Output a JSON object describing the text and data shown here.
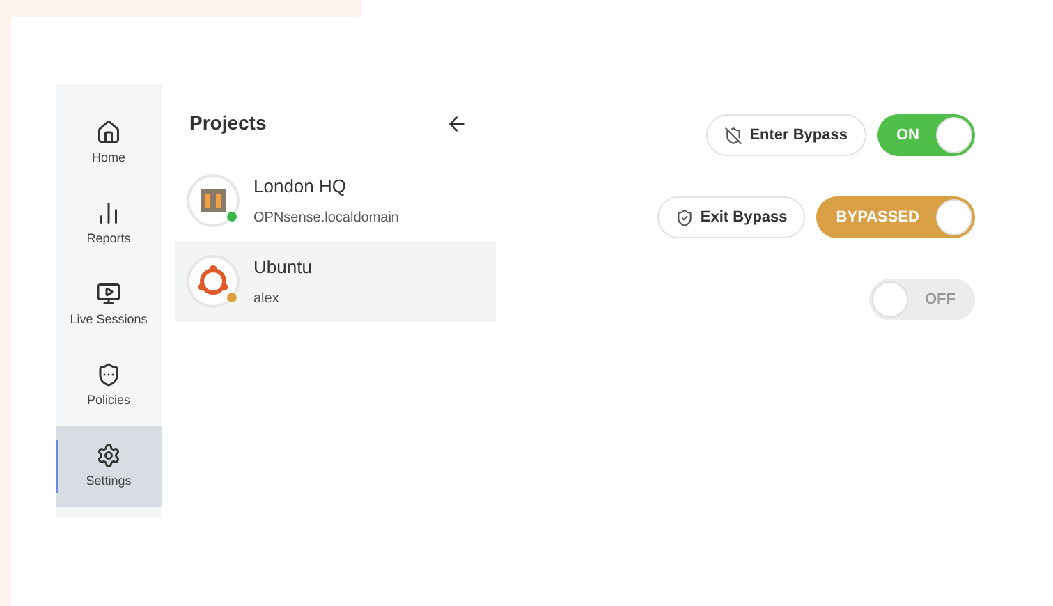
{
  "sidebar": {
    "items": [
      {
        "label": "Home",
        "selected": false
      },
      {
        "label": "Reports",
        "selected": false
      },
      {
        "label": "Live Sessions",
        "selected": false
      },
      {
        "label": "Policies",
        "selected": false
      },
      {
        "label": "Settings",
        "selected": true
      }
    ]
  },
  "projects": {
    "title": "Projects",
    "items": [
      {
        "name": "London HQ",
        "subtitle": "OPNsense.localdomain",
        "color": "#3cb84a",
        "selected": false,
        "kind": "firewall"
      },
      {
        "name": "Ubuntu",
        "subtitle": "alex",
        "color": "#e0a040",
        "selected": true,
        "kind": "ubuntu"
      }
    ]
  },
  "controls": [
    {
      "button": {
        "label": "Enter Bypass",
        "kind": "enter"
      },
      "toggle": {
        "label": "ON",
        "kind": "on"
      }
    },
    {
      "button": {
        "label": "Exit Bypass",
        "kind": "exit"
      },
      "toggle": {
        "label": "BYPASSED",
        "kind": "bypassed"
      }
    },
    {
      "toggle": {
        "label": "OFF",
        "kind": "off"
      }
    }
  ]
}
